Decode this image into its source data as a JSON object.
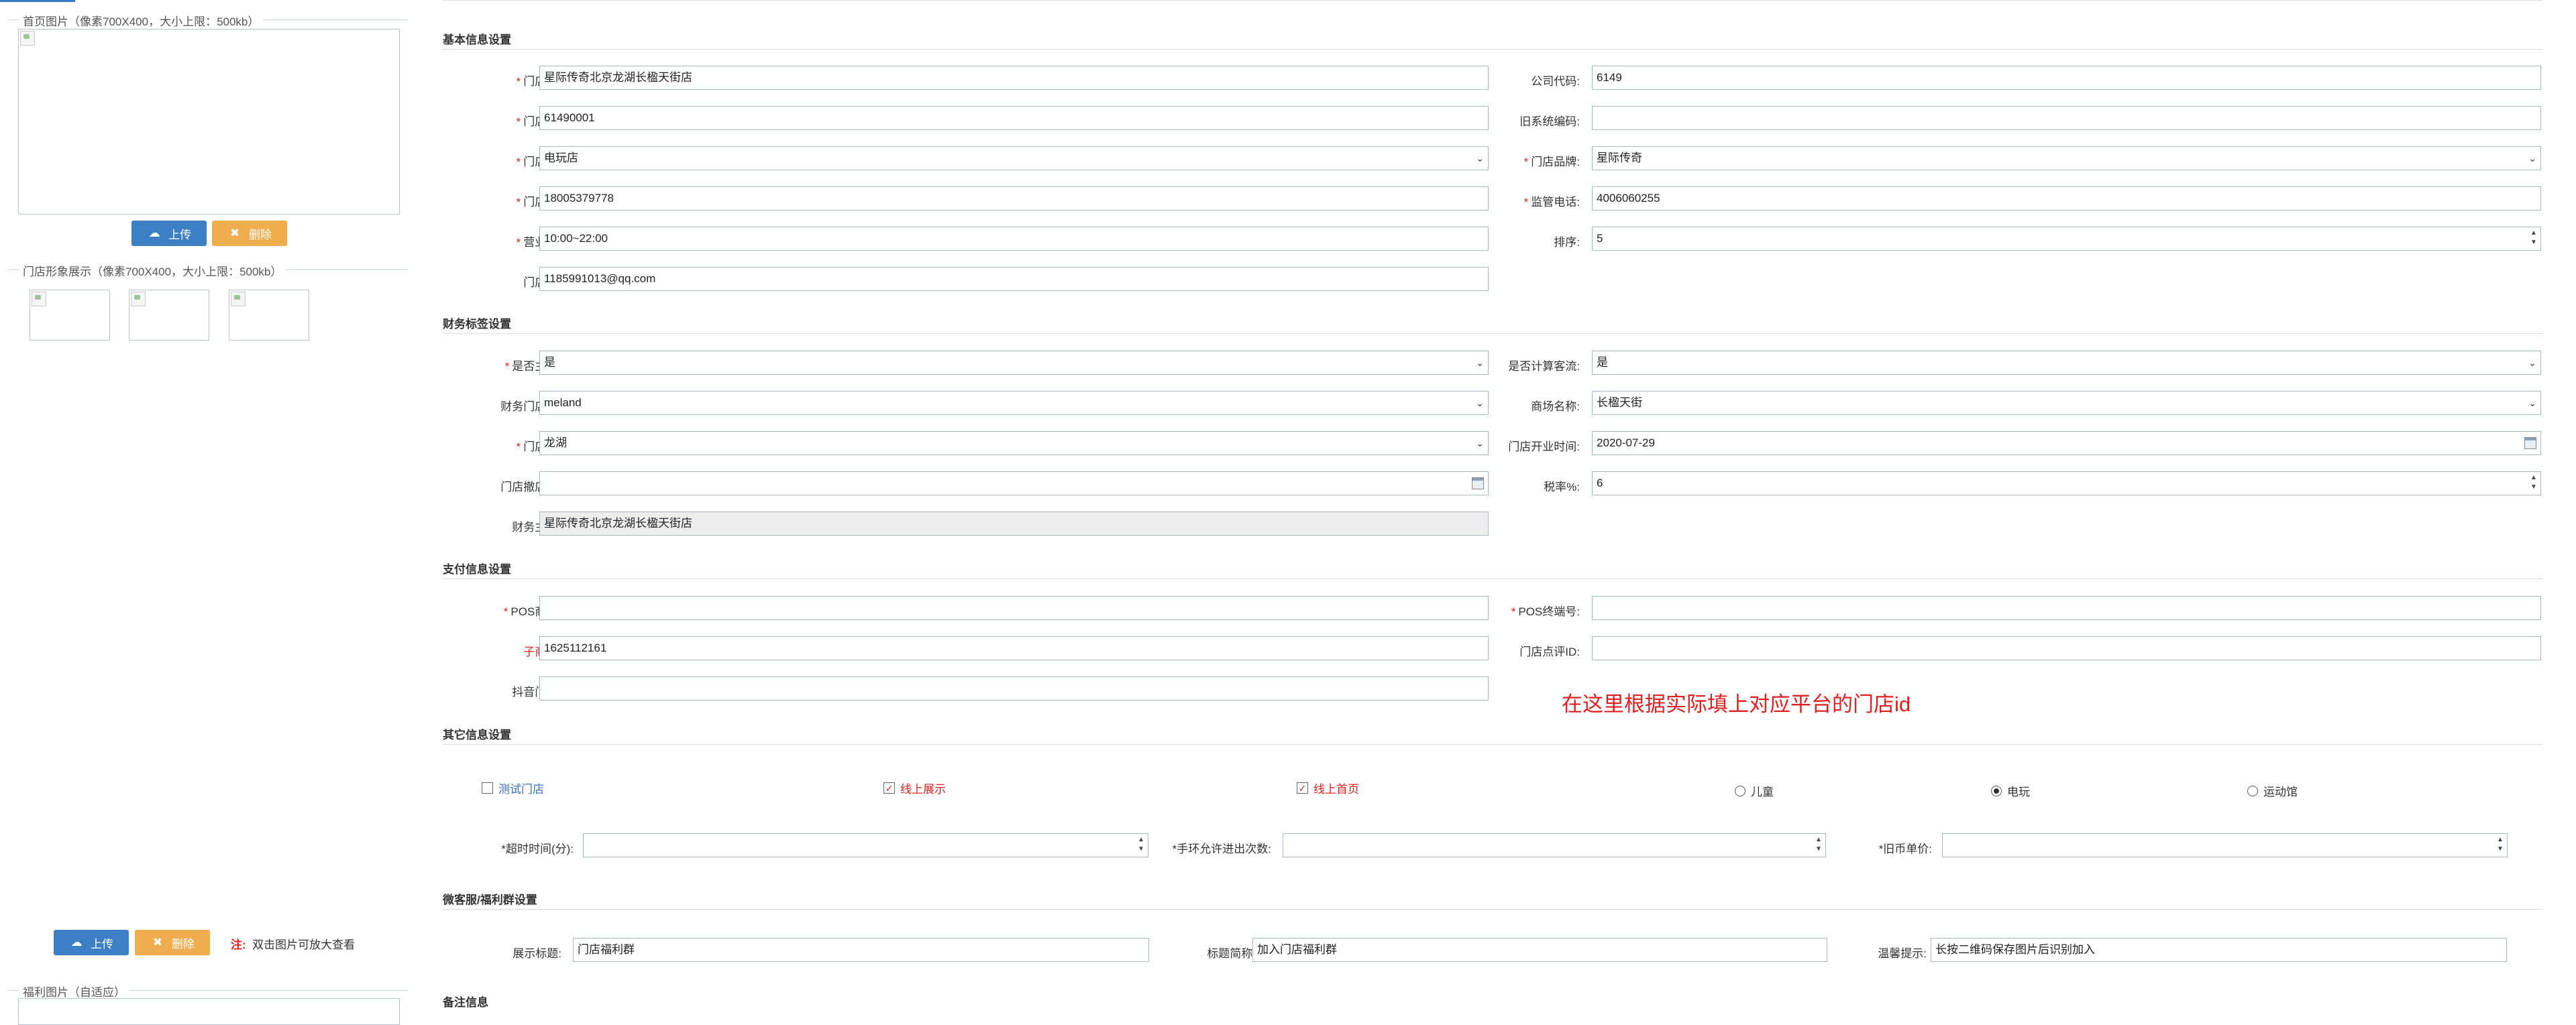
{
  "left_panel": {
    "home_image_legend": "首页图片（像素700X400，大小上限：500kb）",
    "store_image_legend": "门店形象展示（像素700X400，大小上限：500kb）",
    "welfare_image_legend": "福利图片（自适应）",
    "upload_label": "上传",
    "delete_label": "删除",
    "note_prefix": "注:",
    "note_text": "双击图片可放大查看"
  },
  "sections": {
    "basic": "基本信息设置",
    "finance": "财务标签设置",
    "payment": "支付信息设置",
    "other": "其它信息设置",
    "wechat": "微客服/福利群设置",
    "remarks": "备注信息"
  },
  "basic": {
    "store_name_label": "门店名称:",
    "store_name": "星际传奇北京龙湖长楹天街店",
    "company_code_label": "公司代码:",
    "company_code": "6149",
    "store_code_label": "门店编码:",
    "store_code": "61490001",
    "old_code_label": "旧系统编码:",
    "old_code": "",
    "store_type_label": "门店类型:",
    "store_type": "电玩店",
    "brand_label": "门店品牌:",
    "brand": "星际传奇",
    "phone_label": "门店电话:",
    "phone": "18005379778",
    "supervise_phone_label": "监管电话:",
    "supervise_phone": "4006060255",
    "hours_label": "营业时间:",
    "hours": "10:00~22:00",
    "sort_label": "排序:",
    "sort": "5",
    "email_label": "门店邮箱:",
    "email": "1185991013@qq.com"
  },
  "finance": {
    "is_main_label": "是否主门店:",
    "is_main": "是",
    "count_traffic_label": "是否计算客流:",
    "count_traffic": "是",
    "category_label": "财务门店分类:",
    "category": "meland",
    "mall_label": "商场名称:",
    "mall": "长楹天街",
    "system_label": "门店体系:",
    "system": "龙湖",
    "open_date_label": "门店开业时间:",
    "open_date": "2020-07-29",
    "close_date_label": "门店撤店时间:",
    "close_date": "",
    "tax_label": "税率%:",
    "tax": "6",
    "main_store_label": "财务主门店:",
    "main_store": "星际传奇北京龙湖长楹天街店"
  },
  "payment": {
    "pos_merchant_label": "POS商户号:",
    "pos_merchant": "",
    "pos_terminal_label": "POS终端号:",
    "pos_terminal": "",
    "sub_merchant_label": "子商户号:",
    "sub_merchant": "1625112161",
    "dianping_label": "门店点评ID:",
    "dianping": "",
    "douyin_label": "抖音门店ID:",
    "douyin": "",
    "hint": "在这里根据实际填上对应平台的门店id"
  },
  "other": {
    "test_store": "测试门店",
    "online_show": "线上展示",
    "online_home": "线上首页",
    "kids": "儿童",
    "arcade": "电玩",
    "sports": "运动馆",
    "timeout_label": "*超时时间(分):",
    "timeout": "",
    "ring_label": "*手环允许进出次数:",
    "ring": "",
    "coin_label": "*旧币单价:",
    "coin": ""
  },
  "wechat": {
    "title_label": "展示标题:",
    "title": "门店福利群",
    "short_label": "标题简称:",
    "short": "加入门店福利群",
    "tip_label": "温馨提示:",
    "tip": "长按二维码保存图片后识别加入"
  }
}
